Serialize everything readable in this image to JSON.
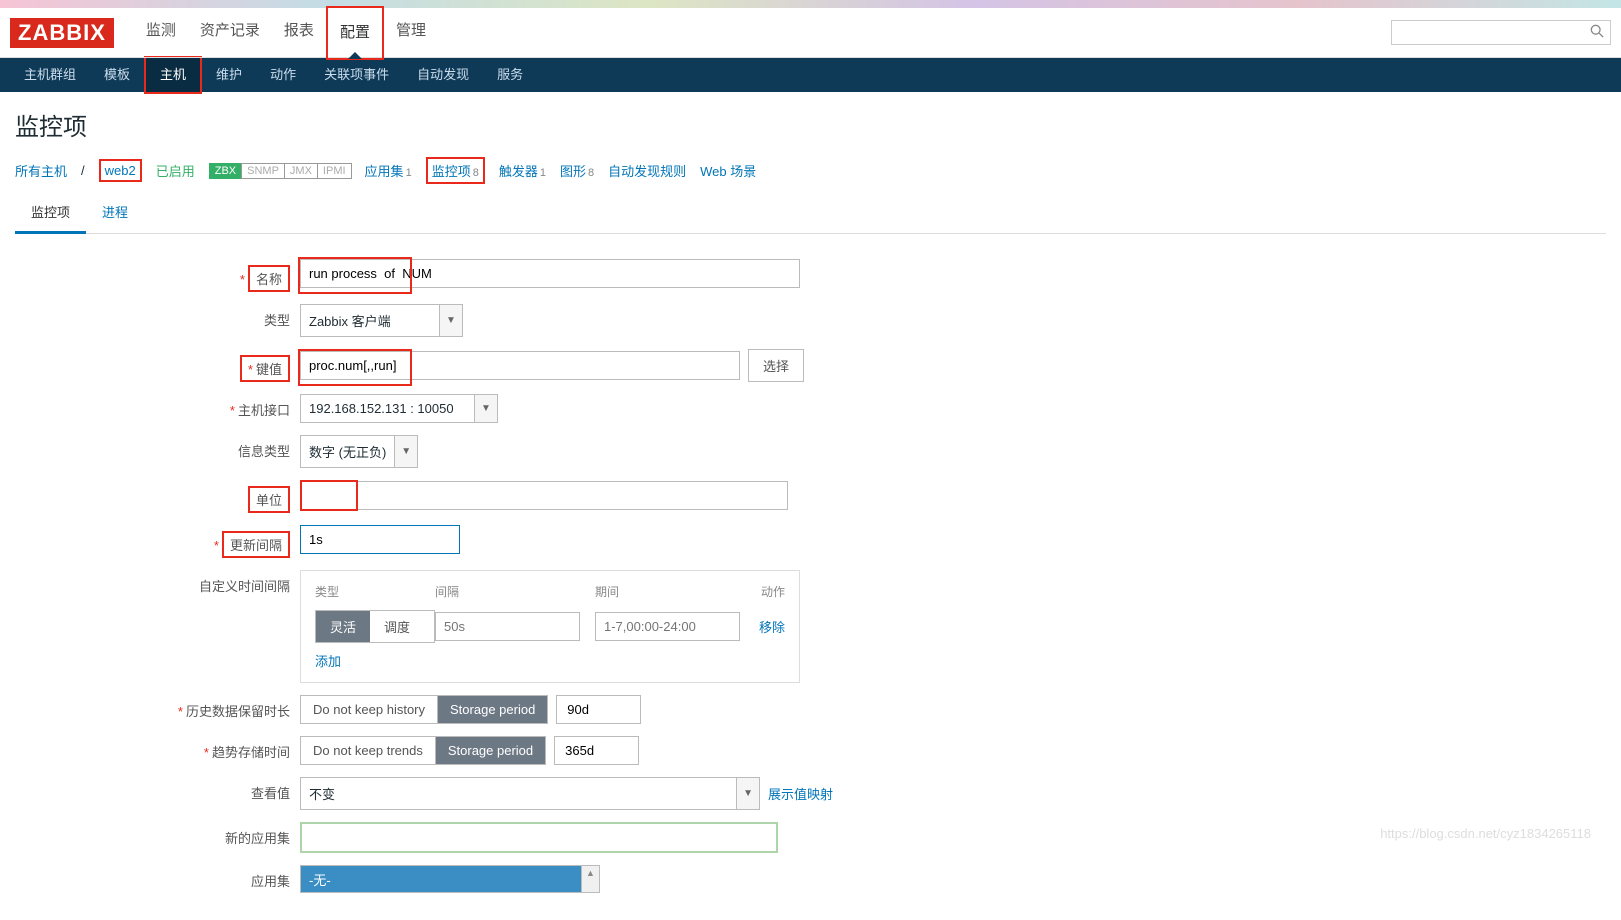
{
  "logo": "ZABBIX",
  "mainNav": {
    "monitoring": "监测",
    "inventory": "资产记录",
    "reports": "报表",
    "config": "配置",
    "admin": "管理"
  },
  "subNav": {
    "hostGroups": "主机群组",
    "templates": "模板",
    "hosts": "主机",
    "maintenance": "维护",
    "actions": "动作",
    "correlation": "关联项事件",
    "discovery": "自动发现",
    "services": "服务"
  },
  "pageTitle": "监控项",
  "hostRow": {
    "allHosts": "所有主机",
    "hostName": "web2",
    "enabled": "已启用",
    "tags": {
      "zbx": "ZBX",
      "snmp": "SNMP",
      "jmx": "JMX",
      "ipmi": "IPMI"
    },
    "applications": "应用集",
    "appCount": "1",
    "items": "监控项",
    "itemCount": "8",
    "triggers": "触发器",
    "trigCount": "1",
    "graphs": "图形",
    "graphCount": "8",
    "discovery": "自动发现规则",
    "webScenarios": "Web 场景"
  },
  "tabs": {
    "item": "监控项",
    "process": "进程"
  },
  "form": {
    "nameLabel": "名称",
    "nameValue": "run process  of  NUM",
    "typeLabel": "类型",
    "typeValue": "Zabbix 客户端",
    "keyLabel": "键值",
    "keyValue": "proc.num[,,run]",
    "keySelect": "选择",
    "interfaceLabel": "主机接口",
    "interfaceValue": "192.168.152.131 : 10050",
    "infoTypeLabel": "信息类型",
    "infoTypeValue": "数字 (无正负)",
    "unitLabel": "单位",
    "unitValue": "",
    "updateIntervalLabel": "更新间隔",
    "updateIntervalValue": "1s",
    "customIntervalLabel": "自定义时间间隔",
    "ci": {
      "typeHeader": "类型",
      "intervalHeader": "间隔",
      "periodHeader": "期间",
      "actionHeader": "动作",
      "flexible": "灵活",
      "scheduling": "调度",
      "intervalPlaceholder": "50s",
      "periodPlaceholder": "1-7,00:00-24:00",
      "remove": "移除",
      "add": "添加"
    },
    "historyLabel": "历史数据保留时长",
    "historyNoKeep": "Do not keep history",
    "historyStorage": "Storage period",
    "historyValue": "90d",
    "trendLabel": "趋势存储时间",
    "trendNoKeep": "Do not keep trends",
    "trendStorage": "Storage period",
    "trendValue": "365d",
    "showValueLabel": "查看值",
    "showValueValue": "不变",
    "showValueMapping": "展示值映射",
    "newAppLabel": "新的应用集",
    "appLabel": "应用集",
    "appNone": "-无-"
  },
  "watermark": "https://blog.csdn.net/cyz1834265118"
}
